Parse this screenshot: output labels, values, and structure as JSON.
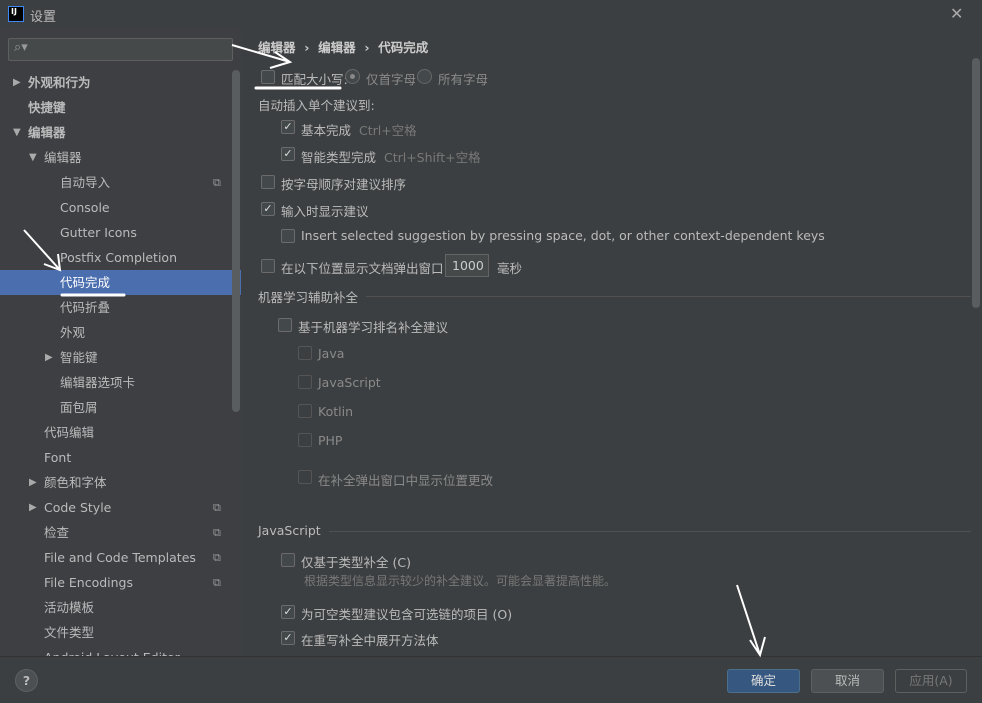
{
  "window": {
    "title": "设置",
    "app_icon": "IJ",
    "close": "✕"
  },
  "search": {
    "placeholder": "",
    "icon": "search-icon"
  },
  "sidebar": {
    "items": [
      {
        "label": "外观和行为",
        "arrow": "▶",
        "bold": true
      },
      {
        "label": "快捷键",
        "bold": true
      },
      {
        "label": "编辑器",
        "arrow": "▼",
        "bold": true
      },
      {
        "label": "编辑器",
        "arrow": "▼"
      },
      {
        "label": "自动导入",
        "copy": true
      },
      {
        "label": "Console"
      },
      {
        "label": "Gutter Icons"
      },
      {
        "label": "Postfix Completion"
      },
      {
        "label": "代码完成",
        "selected": true
      },
      {
        "label": "代码折叠"
      },
      {
        "label": "外观"
      },
      {
        "label": "智能键",
        "arrow": "▶"
      },
      {
        "label": "编辑器选项卡"
      },
      {
        "label": "面包屑"
      },
      {
        "label": "代码编辑"
      },
      {
        "label": "Font"
      },
      {
        "label": "颜色和字体",
        "arrow": "▶"
      },
      {
        "label": "Code Style",
        "arrow": "▶",
        "copy": true
      },
      {
        "label": "检查",
        "copy": true
      },
      {
        "label": "File and Code Templates",
        "copy": true
      },
      {
        "label": "File Encodings",
        "copy": true
      },
      {
        "label": "活动模板"
      },
      {
        "label": "文件类型"
      },
      {
        "label": "Android Layout Editor"
      }
    ]
  },
  "breadcrumb": [
    "编辑器",
    "编辑器",
    "代码完成"
  ],
  "breadcrumb_sep": "›",
  "content": {
    "match_case": {
      "label": "匹配大小写:",
      "checked": false,
      "opt1": "仅首字母",
      "opt2": "所有字母"
    },
    "auto_insert_label": "自动插入单个建议到:",
    "basic": {
      "label": "基本完成",
      "shortcut": "Ctrl+空格",
      "checked": true
    },
    "smart": {
      "label": "智能类型完成",
      "shortcut": "Ctrl+Shift+空格",
      "checked": true
    },
    "sort_alpha": {
      "label": "按字母顺序对建议排序",
      "checked": false
    },
    "show_typing": {
      "label": "输入时显示建议",
      "checked": true
    },
    "insert_selected": {
      "label": "Insert selected suggestion by pressing space, dot, or other context-dependent keys",
      "checked": false
    },
    "doc_popup": {
      "label": "在以下位置显示文档弹出窗口",
      "value": "1000",
      "unit": "毫秒",
      "checked": false
    },
    "ml_section": "机器学习辅助补全",
    "ml_rank": {
      "label": "基于机器学习排名补全建议",
      "checked": false
    },
    "ml_langs": [
      "Java",
      "JavaScript",
      "Kotlin",
      "PHP"
    ],
    "ml_show_pos": "在补全弹出窗口中显示位置更改",
    "js_section": "JavaScript",
    "js_type_only": {
      "label": "仅基于类型补全 (C)",
      "hint": "根据类型信息显示较少的补全建议。可能会显著提高性能。",
      "checked": false
    },
    "js_nullable": {
      "label": "为可空类型建议包含可选链的项目 (O)",
      "checked": true
    },
    "js_expand": {
      "label": "在重写补全中展开方法体",
      "checked": true
    }
  },
  "footer": {
    "help": "?",
    "ok": "确定",
    "cancel": "取消",
    "apply": "应用(A)"
  },
  "colors": {
    "selection": "#4b6eaf",
    "ok_button": "#365880",
    "bg": "#3c3f41"
  }
}
